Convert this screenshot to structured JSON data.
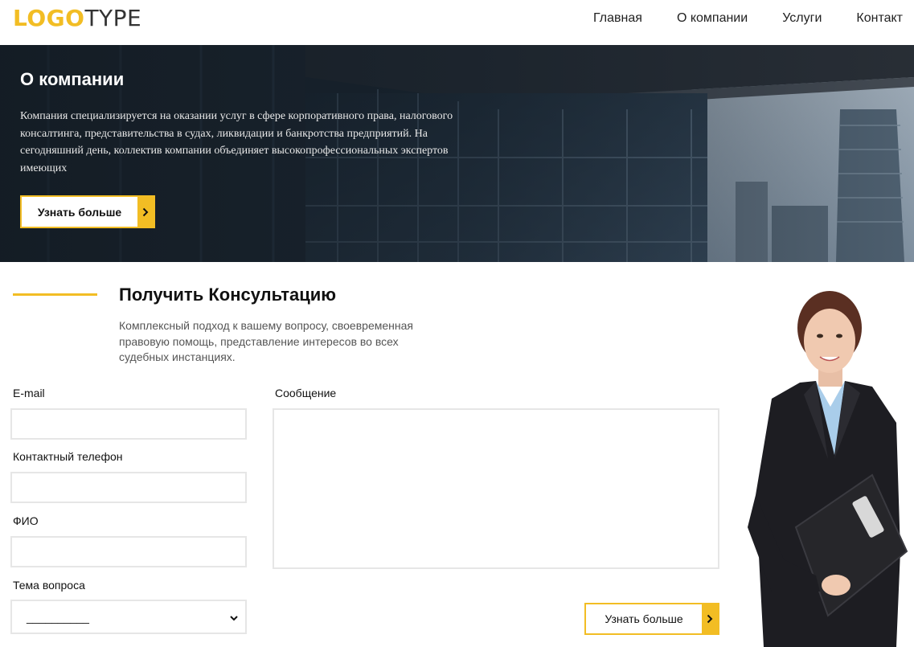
{
  "header": {
    "logo_bold": "LOGO",
    "logo_thin": "TYPE",
    "nav": [
      "Главная",
      "О компании",
      "Услуги",
      "Контакт"
    ]
  },
  "hero": {
    "title": "О компании",
    "text": "Компания специализируется на оказании услуг в сфере корпоративного права, налогового консалтинга, представительства в судах, ликвидации и банкротства предприятий. На сегодняшний день, коллектив компании объединяет высокопрофессиональных экспертов имеющих",
    "button_label": "Узнать больше"
  },
  "consult": {
    "title": "Получить Консультацию",
    "description": "Комплексный подход к вашему вопросу, своевременная правовую помощь, представление интересов во всех судебных инстанциях.",
    "email_label": "E-mail",
    "email_value": "",
    "phone_label": "Контактный телефон",
    "phone_value": "",
    "fio_label": "ФИО",
    "fio_value": "",
    "topic_label": "Тема вопроса",
    "topic_selected": "__________",
    "message_label": "Сообщение",
    "message_value": "",
    "submit_label": "Узнать больше"
  },
  "colors": {
    "accent": "#f2bd24",
    "text": "#111111",
    "muted": "#555555",
    "border": "#e6e6e6"
  }
}
